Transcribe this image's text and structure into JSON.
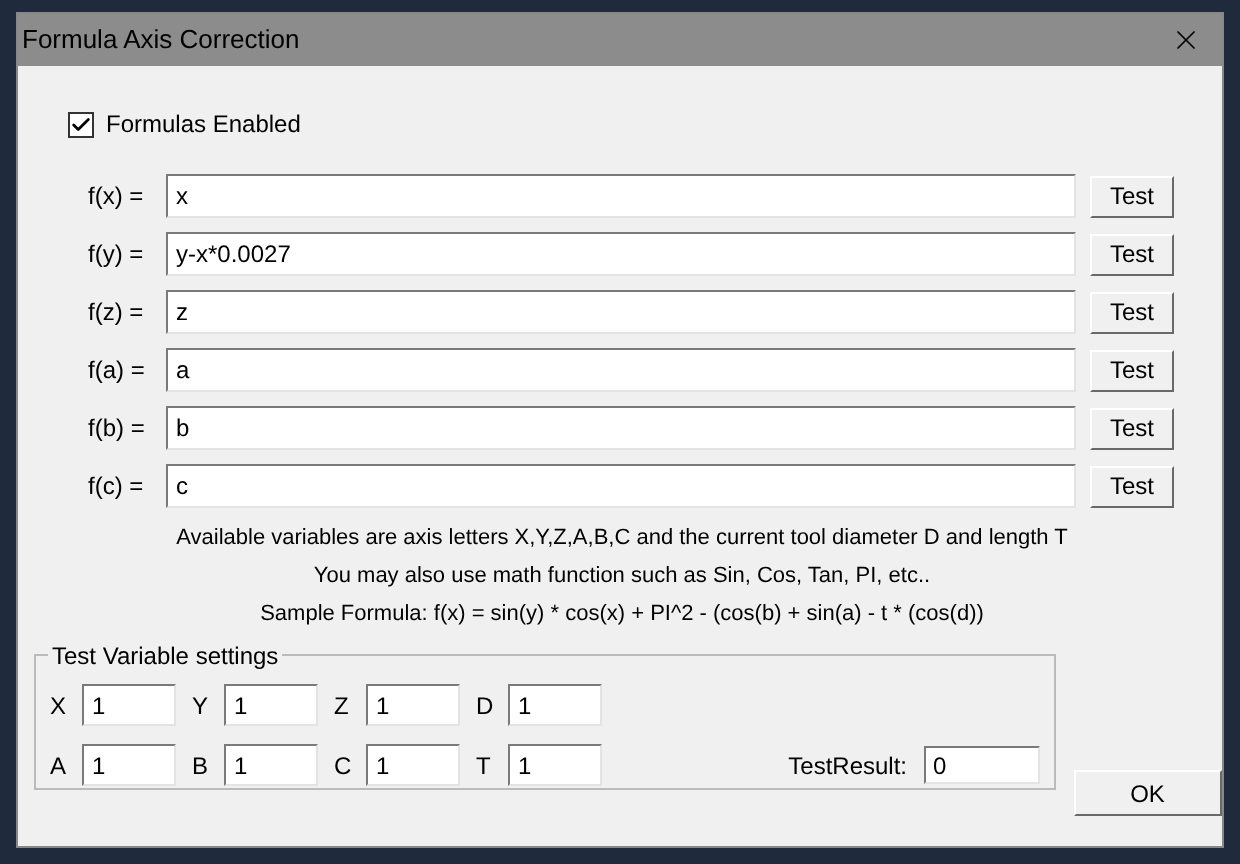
{
  "window": {
    "title": "Formula Axis Correction"
  },
  "formulas_enabled": {
    "label": "Formulas Enabled",
    "checked": true
  },
  "formulas": [
    {
      "label": "f(x) =",
      "value": "x",
      "button": "Test"
    },
    {
      "label": "f(y) =",
      "value": "y-x*0.0027",
      "button": "Test"
    },
    {
      "label": "f(z) =",
      "value": "z",
      "button": "Test"
    },
    {
      "label": "f(a) =",
      "value": "a",
      "button": "Test"
    },
    {
      "label": "f(b) =",
      "value": "b",
      "button": "Test"
    },
    {
      "label": "f(c) =",
      "value": "c",
      "button": "Test"
    }
  ],
  "notes": [
    "Available variables are axis letters X,Y,Z,A,B,C and the current tool diameter D and length T",
    "You may also use math function such as Sin, Cos, Tan, PI, etc..",
    "Sample Formula: f(x) =  sin(y) * cos(x) + PI^2 - (cos(b) + sin(a) - t * (cos(d))"
  ],
  "test_variables": {
    "title": "Test Variable settings",
    "fields": [
      {
        "label": "X",
        "value": "1"
      },
      {
        "label": "Y",
        "value": "1"
      },
      {
        "label": "Z",
        "value": "1"
      },
      {
        "label": "D",
        "value": "1"
      },
      {
        "label": "A",
        "value": "1"
      },
      {
        "label": "B",
        "value": "1"
      },
      {
        "label": "C",
        "value": "1"
      },
      {
        "label": "T",
        "value": "1"
      }
    ],
    "result": {
      "label": "TestResult:",
      "value": "0"
    }
  },
  "buttons": [
    {
      "label": "OK"
    }
  ]
}
